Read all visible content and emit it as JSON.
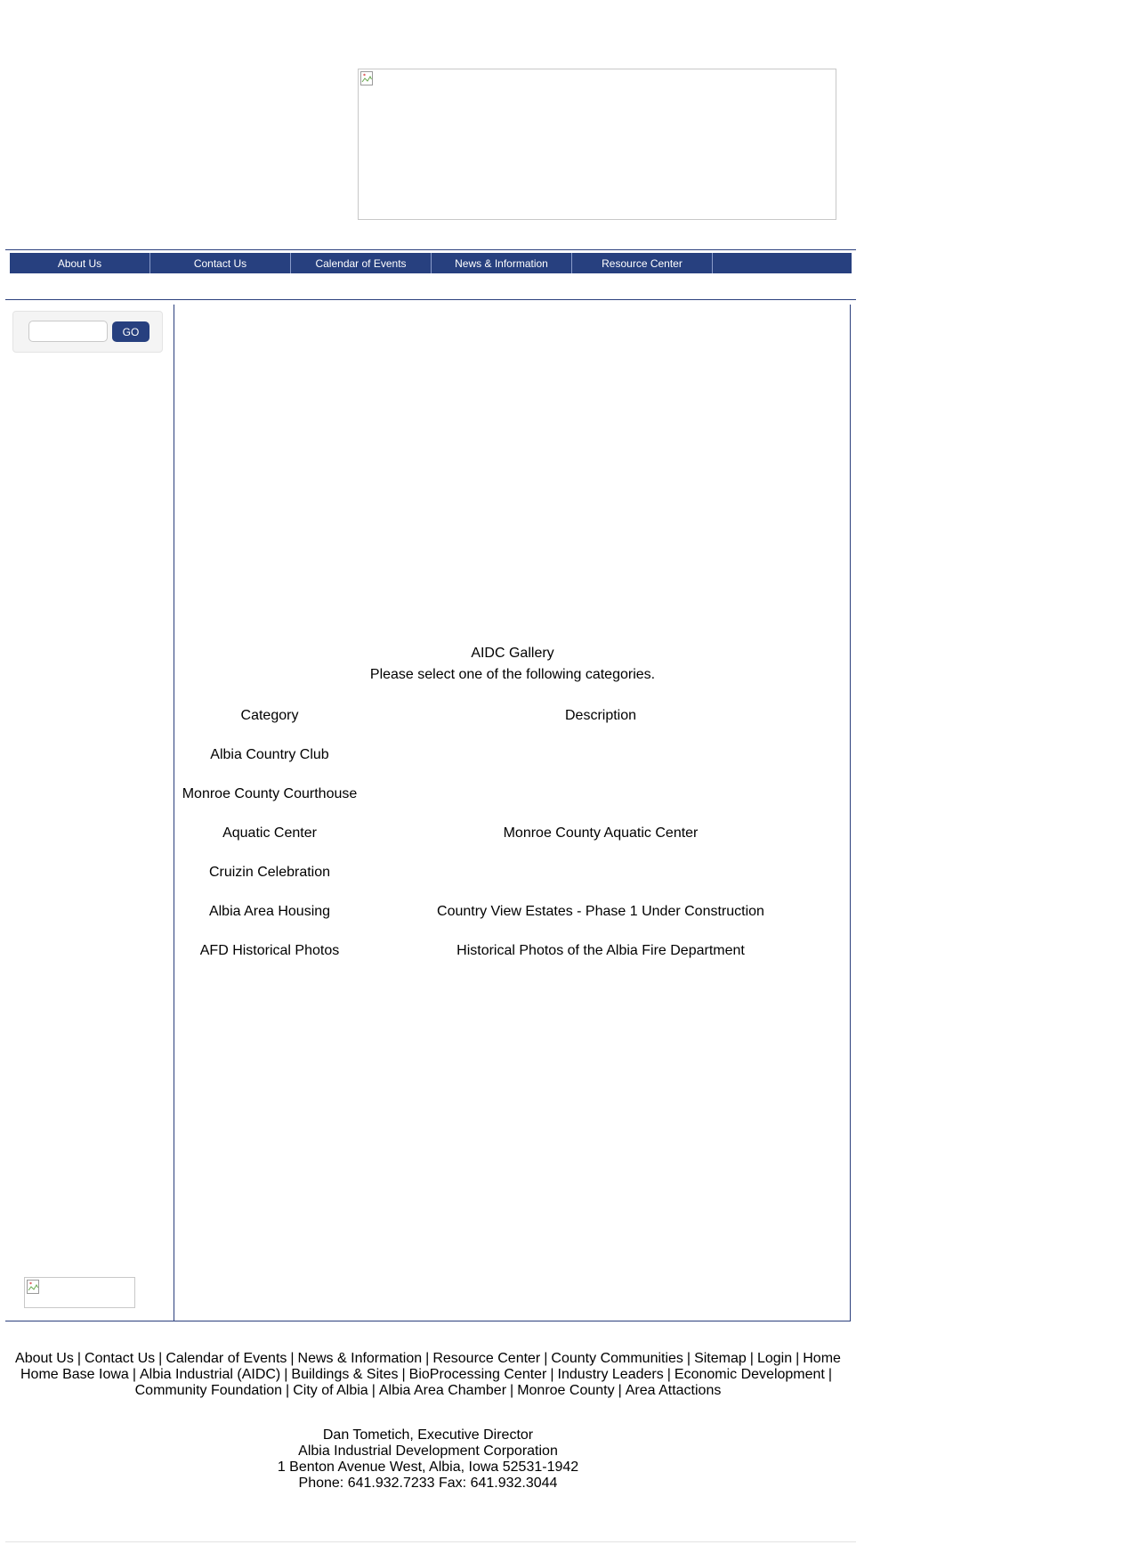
{
  "nav": {
    "items": [
      "About Us",
      "Contact Us",
      "Calendar of Events",
      "News & Information",
      "Resource Center"
    ]
  },
  "search": {
    "value": "",
    "placeholder": "",
    "button_label": "GO"
  },
  "gallery": {
    "title": "AIDC Gallery",
    "subtitle": "Please select one of the following categories.",
    "headers": {
      "category": "Category",
      "description": "Description"
    },
    "rows": [
      {
        "category": "Albia Country Club",
        "description": ""
      },
      {
        "category": "Monroe County Courthouse",
        "description": ""
      },
      {
        "category": "Aquatic Center",
        "description": "Monroe County Aquatic Center"
      },
      {
        "category": "Cruizin Celebration",
        "description": ""
      },
      {
        "category": "Albia Area Housing",
        "description": "Country View Estates - Phase 1 Under Construction"
      },
      {
        "category": "AFD Historical Photos",
        "description": "Historical Photos of the Albia Fire Department"
      }
    ]
  },
  "footer": {
    "line1": [
      "About Us",
      "Contact Us",
      "Calendar of Events",
      "News & Information",
      "Resource Center",
      "County Communities",
      "Sitemap",
      "Login",
      "Home"
    ],
    "line2": [
      "Home Base Iowa",
      "Albia Industrial (AIDC)",
      "Buildings & Sites",
      "BioProcessing Center",
      "Industry Leaders",
      "Economic Development"
    ],
    "line3": [
      "Community Foundation",
      "City of Albia",
      "Albia Area Chamber",
      "Monroe County",
      "Area Attactions"
    ],
    "separator": "|"
  },
  "contact": {
    "name": "Dan Tometich, Executive Director",
    "org": "Albia Industrial Development Corporation",
    "address": "1 Benton Avenue West, Albia, Iowa 52531-1942",
    "phone": "Phone: 641.932.7233 Fax: 641.932.3044"
  },
  "colors": {
    "brand_navy": "#27407f",
    "rule": "#2b3f7d"
  }
}
